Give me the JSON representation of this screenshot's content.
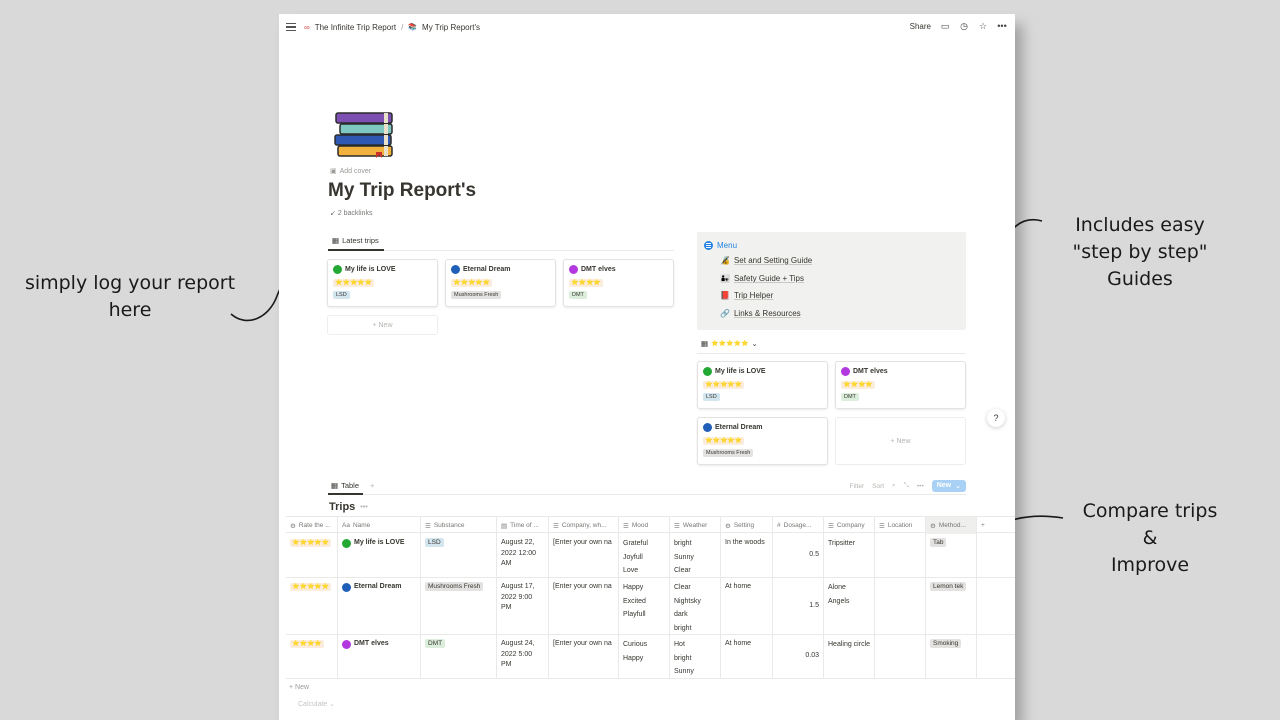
{
  "annotations": {
    "left": [
      "simply log your report",
      "here"
    ],
    "right_top": [
      "Includes easy",
      "\"step by step\"",
      "Guides"
    ],
    "right_bottom": [
      "Compare trips",
      "&",
      "Improve"
    ]
  },
  "topbar": {
    "crumb_parent": "The Infinite Trip Report",
    "crumb_current": "My Trip Report's",
    "share": "Share"
  },
  "page": {
    "add_cover": "Add cover",
    "title": "My Trip Report's",
    "backlinks": "2 backlinks"
  },
  "latest": {
    "tab": "Latest trips",
    "new": "+ New",
    "cards": [
      {
        "name": "My life is LOVE",
        "stars": "⭐⭐⭐⭐⭐",
        "tag": "LSD",
        "dot": "#22a833",
        "tag_bg": "#d3e5ef"
      },
      {
        "name": "Eternal Dream",
        "stars": "⭐⭐⭐⭐⭐",
        "tag": "Mushrooms Fresh",
        "dot": "#1f5fb8",
        "tag_bg": "#e3e2e0"
      },
      {
        "name": "DMT elves",
        "stars": "⭐⭐⭐⭐",
        "tag": "DMT",
        "dot": "#b338e0",
        "tag_bg": "#dbeddb"
      }
    ]
  },
  "menu": {
    "title": "Menu",
    "items": [
      {
        "icon": "🔏",
        "label": "Set and Setting Guide"
      },
      {
        "icon": "👨‍👧",
        "label": "Safety Guide + Tips"
      },
      {
        "icon": "📕",
        "label": "Trip Helper"
      },
      {
        "icon": "🔗",
        "label": "Links & Resources"
      }
    ]
  },
  "rated": {
    "tab": "⭐⭐⭐⭐⭐",
    "new": "+ New",
    "cards": [
      {
        "name": "My life is LOVE",
        "stars": "⭐⭐⭐⭐⭐",
        "tag": "LSD",
        "dot": "#22a833",
        "tag_bg": "#d3e5ef"
      },
      {
        "name": "DMT elves",
        "stars": "⭐⭐⭐⭐",
        "tag": "DMT",
        "dot": "#b338e0",
        "tag_bg": "#dbeddb"
      },
      {
        "name": "Eternal Dream",
        "stars": "⭐⭐⭐⭐⭐",
        "tag": "Mushrooms Fresh",
        "dot": "#1f5fb8",
        "tag_bg": "#e3e2e0"
      }
    ]
  },
  "help": "?",
  "table": {
    "tab": "Table",
    "filter": "Filter",
    "sort": "Sort",
    "new": "New",
    "title": "Trips",
    "columns": [
      "Rate the ...",
      "Name",
      "Substance",
      "Time of ...",
      "Company, wh...",
      "Mood",
      "Weather",
      "Setting",
      "Dosage...",
      "Company",
      "Location",
      "Method..."
    ],
    "rows": [
      {
        "rate": "⭐⭐⭐⭐⭐",
        "name": "My life is LOVE",
        "dot": "#22a833",
        "substance": "LSD",
        "sub_bg": "#d3e5ef",
        "time": "August 22, 2022 12:00 AM",
        "company_wh": "[Enter your own na",
        "mood": [
          "Grateful",
          "Joyfull",
          "Love"
        ],
        "weather": [
          "bright",
          "Sunny",
          "Clear"
        ],
        "setting": "In the woods",
        "dosage": "0.5",
        "company": [
          "Tripsitter"
        ],
        "location": "",
        "method": "Tab"
      },
      {
        "rate": "⭐⭐⭐⭐⭐",
        "name": "Eternal Dream",
        "dot": "#1f5fb8",
        "substance": "Mushrooms Fresh",
        "sub_bg": "#e3e2e0",
        "time": "August 17, 2022 9:00 PM",
        "company_wh": "[Enter your own na",
        "mood": [
          "Happy",
          "Excited",
          "Playfull"
        ],
        "weather": [
          "Clear",
          "Nightsky",
          "dark",
          "bright"
        ],
        "setting": "At home",
        "dosage": "1.5",
        "company": [
          "Alone",
          "Angels"
        ],
        "location": "",
        "method": "Lemon tek"
      },
      {
        "rate": "⭐⭐⭐⭐",
        "name": "DMT elves",
        "dot": "#b338e0",
        "substance": "DMT",
        "sub_bg": "#dbeddb",
        "time": "August 24, 2022 5:00 PM",
        "company_wh": "[Enter your own na",
        "mood": [
          "Curious",
          "Happy"
        ],
        "weather": [
          "Hot",
          "bright",
          "Sunny"
        ],
        "setting": "At home",
        "dosage": "0.03",
        "company": [
          "Healing circle"
        ],
        "location": "",
        "method": "Smoking"
      }
    ],
    "add_row": "+ New",
    "calculate": "Calculate ⌄"
  }
}
